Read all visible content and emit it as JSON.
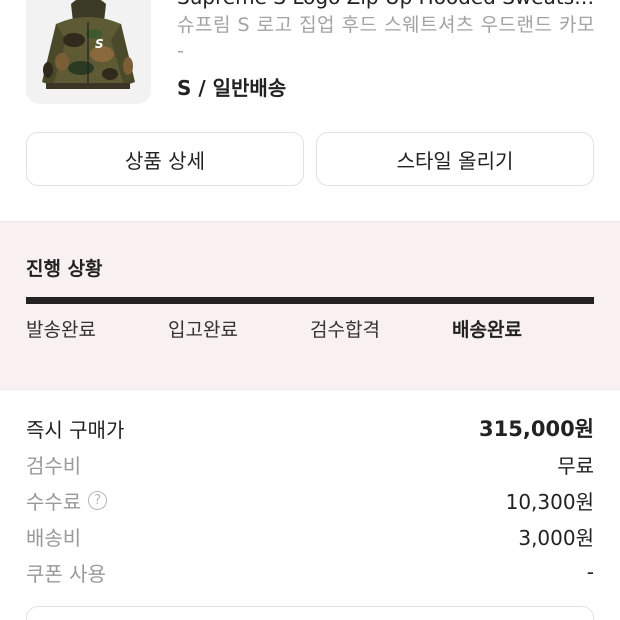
{
  "product": {
    "title": "Supreme S Logo Zip Up Hooded Sweatshirt Woodland Camo",
    "subtitle": "슈프림 S 로고 집업 후드 스웨트셔츠 우드랜드 카모",
    "subtitle_cont": "-",
    "option": "S / 일반배송",
    "image_icon": "camo-hoodie-image"
  },
  "actions": {
    "detail_label": "상품 상세",
    "style_label": "스타일 올리기"
  },
  "progress": {
    "title": "진행 상황",
    "steps": [
      "발송완료",
      "입고완료",
      "검수합격",
      "배송완료"
    ],
    "current_step": 4,
    "fill_fraction": 1.0
  },
  "prices": {
    "buy_now": {
      "label": "즉시 구매가",
      "value": "315,000원"
    },
    "inspection_fee": {
      "label": "검수비",
      "value": "무료"
    },
    "commission": {
      "label": "수수료",
      "value": "10,300원",
      "help_icon": "question-circle-icon"
    },
    "shipping": {
      "label": "배송비",
      "value": "3,000원"
    },
    "coupon": {
      "label": "쿠폰 사용",
      "value": "-"
    }
  },
  "colors": {
    "progress_bg": "#f9f1f1",
    "progress_fill": "#222222",
    "muted_text": "#999999"
  }
}
